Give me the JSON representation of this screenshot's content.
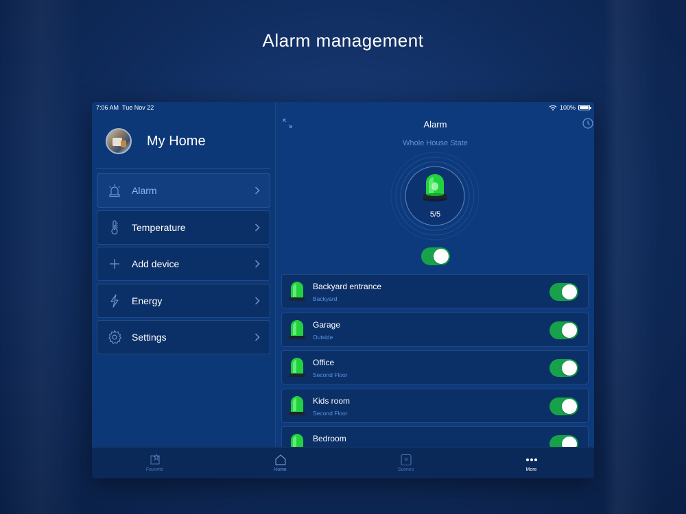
{
  "page_title": "Alarm management",
  "status_bar": {
    "time": "7:06 AM",
    "date": "Tue Nov 22",
    "battery": "100%"
  },
  "sidebar": {
    "home_name": "My Home",
    "items": [
      {
        "label": "Alarm",
        "icon": "siren-icon",
        "active": true
      },
      {
        "label": "Temperature",
        "icon": "thermometer-icon",
        "active": false
      },
      {
        "label": "Add device",
        "icon": "plus-icon",
        "active": false
      },
      {
        "label": "Energy",
        "icon": "lightning-icon",
        "active": false
      },
      {
        "label": "Settings",
        "icon": "gear-icon",
        "active": false
      }
    ]
  },
  "main": {
    "title": "Alarm",
    "whole_house_label": "Whole House State",
    "active_count": "5/5",
    "master_toggle_on": true,
    "devices": [
      {
        "name": "Backyard entrance",
        "location": "Backyard",
        "on": true
      },
      {
        "name": "Garage",
        "location": "Outside",
        "on": true
      },
      {
        "name": "Office",
        "location": "Second Floor",
        "on": true
      },
      {
        "name": "Kids room",
        "location": "Second Floor",
        "on": true
      },
      {
        "name": "Bedroom",
        "location": "",
        "on": true
      }
    ]
  },
  "tabbar": {
    "tabs": [
      {
        "label": "Favorite",
        "icon": "favorite-icon",
        "active": false
      },
      {
        "label": "Home",
        "icon": "home-icon",
        "active": false
      },
      {
        "label": "Scenes",
        "icon": "scenes-icon",
        "active": false
      },
      {
        "label": "More",
        "icon": "more-icon",
        "active": true
      }
    ]
  },
  "colors": {
    "accent": "#5e93e0",
    "toggle_on": "#17a24a",
    "siren": "#2ee04a"
  }
}
